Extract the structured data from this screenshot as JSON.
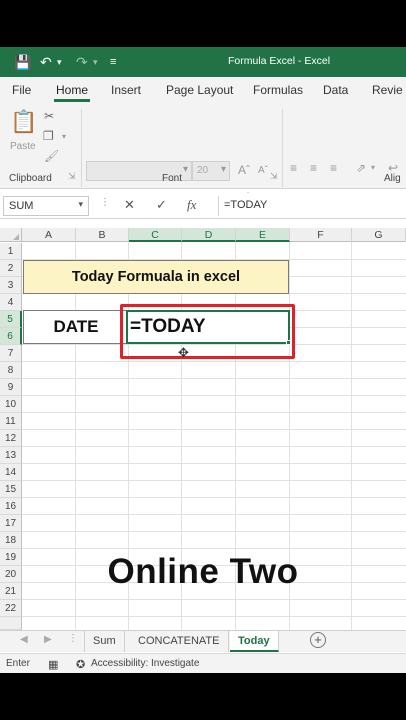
{
  "window": {
    "title": "Formula Excel  -  Excel",
    "accent": "#217346"
  },
  "ribbon_tabs": [
    {
      "label": "File"
    },
    {
      "label": "Home"
    },
    {
      "label": "Insert"
    },
    {
      "label": "Page Layout"
    },
    {
      "label": "Formulas"
    },
    {
      "label": "Data"
    },
    {
      "label": "Revie"
    }
  ],
  "ribbon": {
    "paste_label": "Paste",
    "font_size": "20",
    "groups": {
      "clipboard": "Clipboard",
      "font": "Font",
      "alignment": "Alig"
    }
  },
  "formula_bar": {
    "name_box": "SUM",
    "fx": "fx",
    "value": "=TODAY"
  },
  "columns": [
    "A",
    "B",
    "C",
    "D",
    "E",
    "F",
    "G"
  ],
  "rows": [
    "1",
    "2",
    "3",
    "4",
    "5",
    "6",
    "7",
    "8",
    "9",
    "10",
    "11",
    "12",
    "13",
    "14",
    "15",
    "16",
    "17",
    "18",
    "19",
    "20",
    "21",
    "22"
  ],
  "cells": {
    "title": "Today Formuala in excel",
    "date_label": "DATE",
    "editing": "=TODAY"
  },
  "overlay_text": "Online Two",
  "sheets": [
    {
      "label": "Sum"
    },
    {
      "label": "CONCATENATE"
    },
    {
      "label": "Today"
    }
  ],
  "status": {
    "mode": "Enter",
    "accessibility": "Accessibility: Investigate"
  }
}
